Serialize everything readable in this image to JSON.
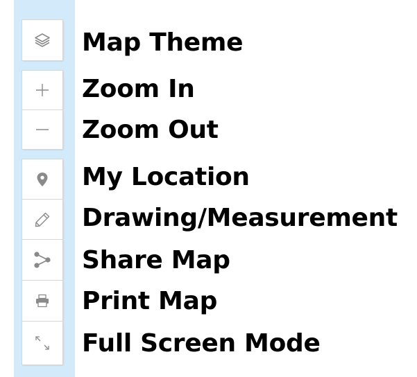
{
  "controls": [
    {
      "label": "Map Theme",
      "icon": "layers-icon"
    },
    {
      "label": "Zoom In",
      "icon": "plus-icon"
    },
    {
      "label": "Zoom Out",
      "icon": "minus-icon"
    },
    {
      "label": "My Location",
      "icon": "location-pin-icon"
    },
    {
      "label": "Drawing/Measurement",
      "icon": "pencil-icon"
    },
    {
      "label": "Share Map",
      "icon": "share-icon"
    },
    {
      "label": "Print Map",
      "icon": "printer-icon"
    },
    {
      "label": "Full Screen Mode",
      "icon": "fullscreen-icon"
    }
  ],
  "colors": {
    "strip": "#d3eafb",
    "button": "#ffffff",
    "icon": "#8a8a8a",
    "text": "#000000"
  }
}
